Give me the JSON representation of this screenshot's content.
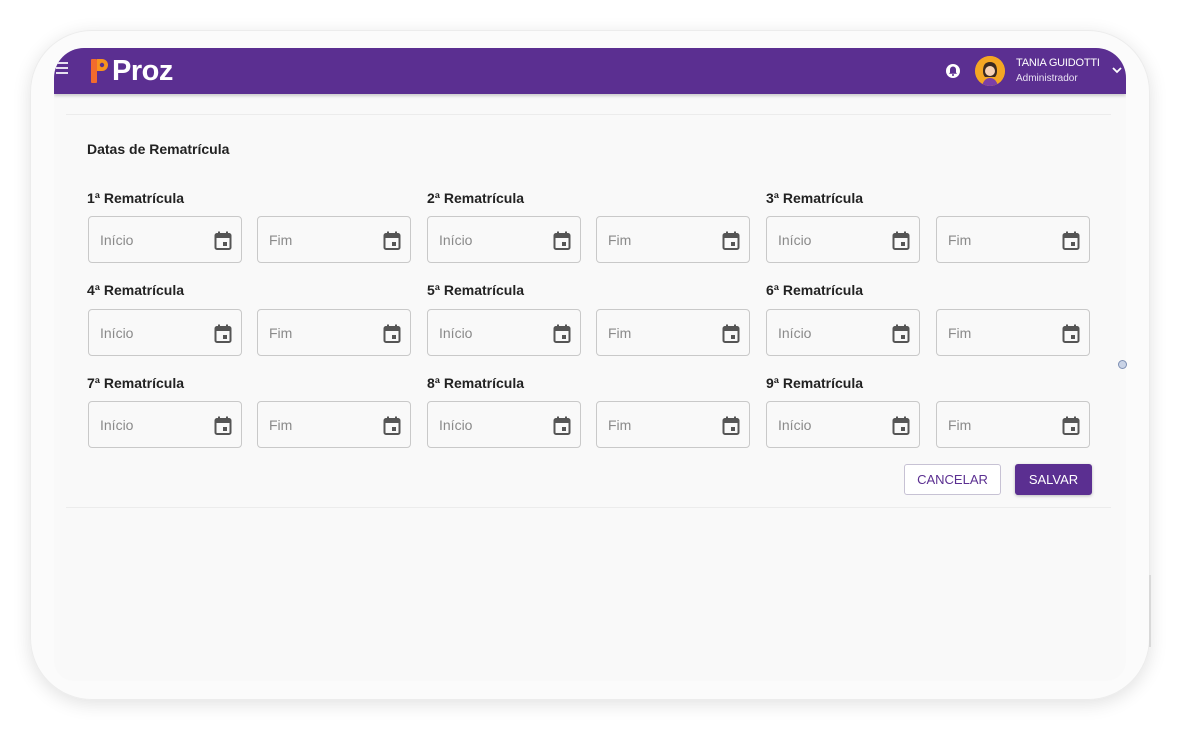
{
  "app": {
    "logo_text": "Proz",
    "brand_color": "#5b2f91"
  },
  "header": {
    "user_name": "TANIA GUIDOTTI",
    "user_role": "Administrador"
  },
  "form": {
    "section_title": "Datas de Rematrícula",
    "groups": [
      {
        "title": "1ª Rematrícula",
        "start_placeholder": "Início",
        "end_placeholder": "Fim"
      },
      {
        "title": "2ª Rematrícula",
        "start_placeholder": "Início",
        "end_placeholder": "Fim"
      },
      {
        "title": "3ª Rematrícula",
        "start_placeholder": "Início",
        "end_placeholder": "Fim"
      },
      {
        "title": "4ª Rematrícula",
        "start_placeholder": "Início",
        "end_placeholder": "Fim"
      },
      {
        "title": "5ª Rematrícula",
        "start_placeholder": "Início",
        "end_placeholder": "Fim"
      },
      {
        "title": "6ª Rematrícula",
        "start_placeholder": "Início",
        "end_placeholder": "Fim"
      },
      {
        "title": "7ª Rematrícula",
        "start_placeholder": "Início",
        "end_placeholder": "Fim"
      },
      {
        "title": "8ª Rematrícula",
        "start_placeholder": "Início",
        "end_placeholder": "Fim"
      },
      {
        "title": "9ª Rematrícula",
        "start_placeholder": "Início",
        "end_placeholder": "Fim"
      }
    ],
    "icons": {
      "date": "calendar-icon"
    }
  },
  "actions": {
    "cancel_label": "CANCELAR",
    "save_label": "SALVAR"
  }
}
